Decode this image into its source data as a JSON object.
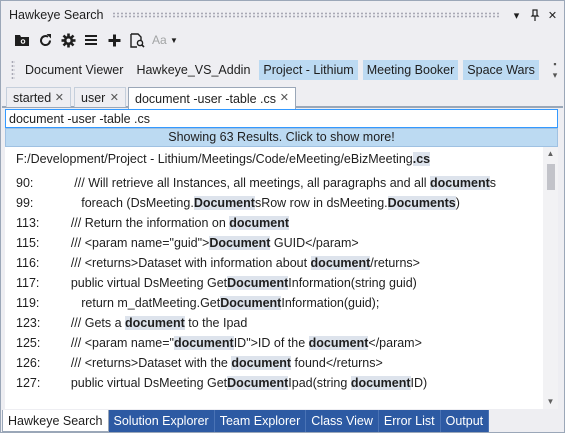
{
  "window": {
    "title": "Hawkeye Search"
  },
  "titlebar_buttons": [
    {
      "name": "dropdown-icon",
      "glyph": "▾"
    },
    {
      "name": "pin-icon",
      "glyph": "📌"
    },
    {
      "name": "close-icon",
      "glyph": "✕"
    }
  ],
  "toolbar": {
    "font_size_label": "Aa"
  },
  "filters": [
    {
      "label": "Document Viewer",
      "active": false
    },
    {
      "label": "Hawkeye_VS_Addin",
      "active": false
    },
    {
      "label": "Project - Lithium",
      "active": true
    },
    {
      "label": "Meeting Booker",
      "active": true
    },
    {
      "label": "Space Wars",
      "active": true
    }
  ],
  "tabs": [
    {
      "label": "started",
      "close": "✕",
      "active": false
    },
    {
      "label": "user",
      "close": "✕",
      "active": false
    },
    {
      "label": "document -user -table .cs",
      "close": "✕",
      "active": true
    }
  ],
  "search": {
    "value": "document -user -table .cs"
  },
  "banner": {
    "text": "Showing 63 Results. Click to show more!"
  },
  "results": {
    "path": [
      "F:/Development/Project - Lithium/Meetings/Code/eMeeting/eBizMeeting",
      ".cs"
    ],
    "rows": [
      {
        "line": "90:",
        "segments": [
          [
            "       /// Will retrieve all Instances, all meetings, all paragraphs and all ",
            false
          ],
          [
            "document",
            true
          ],
          [
            "s",
            false
          ]
        ]
      },
      {
        "line": "99:",
        "segments": [
          [
            "         foreach (DsMeeting.",
            false
          ],
          [
            "Document",
            true
          ],
          [
            "sRow row in dsMeeting.",
            false
          ],
          [
            "Documents",
            true
          ],
          [
            ")",
            false
          ]
        ]
      },
      {
        "line": "113:",
        "segments": [
          [
            "      /// Return the information on ",
            false
          ],
          [
            "document",
            true
          ]
        ]
      },
      {
        "line": "115:",
        "segments": [
          [
            "      /// <param name=\"guid\">",
            false
          ],
          [
            "Document",
            true
          ],
          [
            " GUID</param>",
            false
          ]
        ]
      },
      {
        "line": "116:",
        "segments": [
          [
            "      /// <returns>Dataset with information about ",
            false
          ],
          [
            "document",
            true
          ],
          [
            "/returns>",
            false
          ]
        ]
      },
      {
        "line": "117:",
        "segments": [
          [
            "      public virtual DsMeeting Get",
            false
          ],
          [
            "Document",
            true
          ],
          [
            "Information(string guid)",
            false
          ]
        ]
      },
      {
        "line": "119:",
        "segments": [
          [
            "         return m_datMeeting.Get",
            false
          ],
          [
            "Document",
            true
          ],
          [
            "Information(guid);",
            false
          ]
        ]
      },
      {
        "line": "123:",
        "segments": [
          [
            "      /// Gets a ",
            false
          ],
          [
            "document",
            true
          ],
          [
            " to the Ipad",
            false
          ]
        ]
      },
      {
        "line": "125:",
        "segments": [
          [
            "      /// <param name=\"",
            false
          ],
          [
            "document",
            true
          ],
          [
            "ID\">ID of the ",
            false
          ],
          [
            "document",
            true
          ],
          [
            "</param>",
            false
          ]
        ]
      },
      {
        "line": "126:",
        "segments": [
          [
            "      /// <returns>Dataset with the ",
            false
          ],
          [
            "document",
            true
          ],
          [
            " found</returns>",
            false
          ]
        ]
      },
      {
        "line": "127:",
        "segments": [
          [
            "      public virtual DsMeeting Get",
            false
          ],
          [
            "Document",
            true
          ],
          [
            "Ipad(string ",
            false
          ],
          [
            "document",
            true
          ],
          [
            "ID)",
            false
          ]
        ]
      }
    ]
  },
  "bottom_tabs": [
    {
      "label": "Hawkeye Search",
      "active": true
    },
    {
      "label": "Solution Explorer",
      "active": false
    },
    {
      "label": "Team Explorer",
      "active": false
    },
    {
      "label": "Class View",
      "active": false
    },
    {
      "label": "Error List",
      "active": false
    },
    {
      "label": "Output",
      "active": false
    }
  ],
  "colors": {
    "accent": "#2d5aa3",
    "highlight": "#dde3ec",
    "filter_active": "#bcdaf2",
    "focus": "#3399ff"
  }
}
